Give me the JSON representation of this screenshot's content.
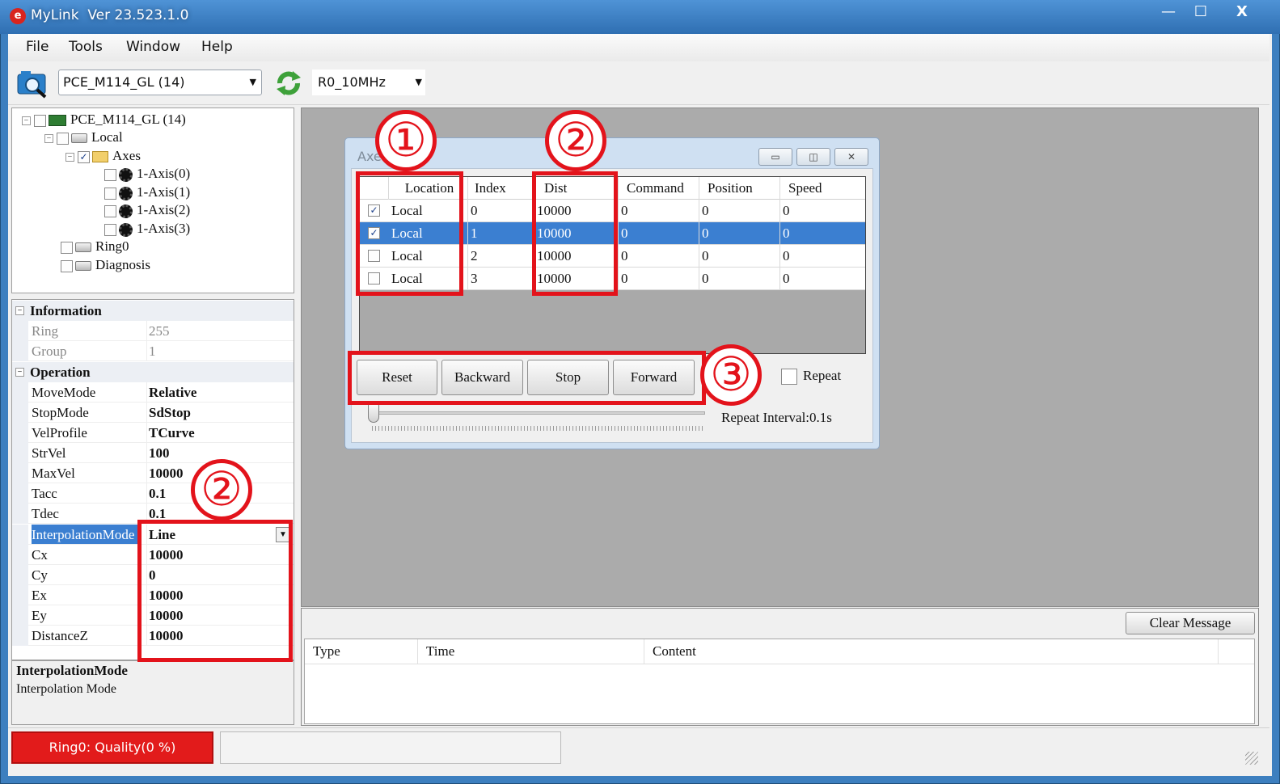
{
  "window": {
    "app_name": "MyLink",
    "version": "Ver 23.523.1.0",
    "logo_letter": "e",
    "minimize": "—",
    "maximize": "☐",
    "close": "X"
  },
  "menu": [
    "File",
    "Tools",
    "Window",
    "Help"
  ],
  "toolbar": {
    "device_combo": "PCE_M114_GL (14)",
    "clock_combo": "R0_10MHz"
  },
  "tree": {
    "root": "PCE_M114_GL (14)",
    "local": "Local",
    "axes": "Axes",
    "axis_items": [
      "1-Axis(0)",
      "1-Axis(1)",
      "1-Axis(2)",
      "1-Axis(3)"
    ],
    "ring0": "Ring0",
    "diagnosis": "Diagnosis"
  },
  "properties": {
    "cat_information": "Information",
    "ring_label": "Ring",
    "ring_value": "255",
    "group_label": "Group",
    "group_value": "1",
    "cat_operation": "Operation",
    "rows": [
      {
        "name": "MoveMode",
        "value": "Relative"
      },
      {
        "name": "StopMode",
        "value": "SdStop"
      },
      {
        "name": "VelProfile",
        "value": "TCurve"
      },
      {
        "name": "StrVel",
        "value": "100"
      },
      {
        "name": "MaxVel",
        "value": "10000"
      },
      {
        "name": "Tacc",
        "value": "0.1"
      },
      {
        "name": "Tdec",
        "value": "0.1"
      },
      {
        "name": "InterpolationMode",
        "value": "Line"
      },
      {
        "name": "Cx",
        "value": "10000"
      },
      {
        "name": "Cy",
        "value": "0"
      },
      {
        "name": "Ex",
        "value": "10000"
      },
      {
        "name": "Ey",
        "value": "10000"
      },
      {
        "name": "DistanceZ",
        "value": "10000"
      }
    ],
    "desc_title": "InterpolationMode",
    "desc_text": "Interpolation Mode"
  },
  "axes_window": {
    "title": "Axe",
    "columns": [
      "Location",
      "Index",
      "Dist",
      "Command",
      "Position",
      "Speed"
    ],
    "rows": [
      {
        "checked": true,
        "location": "Local",
        "index": "0",
        "dist": "10000",
        "command": "0",
        "position": "0",
        "speed": "0"
      },
      {
        "checked": true,
        "location": "Local",
        "index": "1",
        "dist": "10000",
        "command": "0",
        "position": "0",
        "speed": "0"
      },
      {
        "checked": false,
        "location": "Local",
        "index": "2",
        "dist": "10000",
        "command": "0",
        "position": "0",
        "speed": "0"
      },
      {
        "checked": false,
        "location": "Local",
        "index": "3",
        "dist": "10000",
        "command": "0",
        "position": "0",
        "speed": "0"
      }
    ],
    "buttons": {
      "reset": "Reset",
      "backward": "Backward",
      "stop": "Stop",
      "forward": "Forward"
    },
    "repeat_label": "Repeat",
    "repeat_interval": "Repeat Interval:0.1s",
    "win_min": "▭",
    "win_max": "◫",
    "win_close": "✕"
  },
  "annotations": [
    "①",
    "②",
    "③"
  ],
  "messages": {
    "clear_button": "Clear Message",
    "columns": [
      "Type",
      "Time",
      "Content"
    ]
  },
  "status": {
    "quality": "Ring0: Quality(0 %)"
  },
  "colors": {
    "title_bar": "#3d7fbf",
    "selection": "#3b7fd1",
    "annotation_red": "#e3131b",
    "status_error": "#e21b1b"
  }
}
